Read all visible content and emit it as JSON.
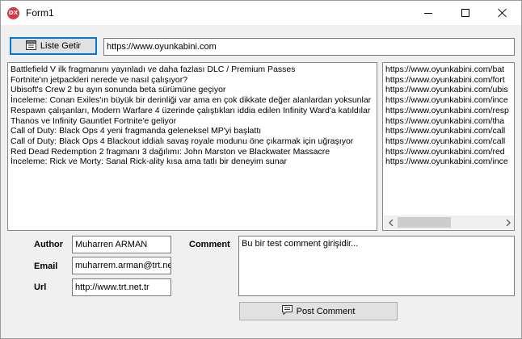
{
  "window": {
    "title": "Form1",
    "app_icon_text": "DX",
    "minimize_icon": "minimize-icon",
    "maximize_icon": "maximize-icon",
    "close_icon": "close-icon"
  },
  "toolbar": {
    "fetch_button_label": "Liste Getir",
    "fetch_button_icon": "window-list-icon",
    "url_value": "https://www.oyunkabini.com"
  },
  "titles_list": [
    "Battlefield V ilk fragmanını yayınladı ve daha fazlası DLC / Premium Passes",
    "Fortnite'ın jetpackleri  nerede  ve nasıl çalışıyor?",
    "Ubisoft's Crew 2 bu ayın sonunda beta sürümüne geçiyor",
    "İnceleme: Conan Exiles'ın büyük bir derinliği var ama en çok dikkate değer alanlardan yoksunlar",
    "Respawn çalışanları, Modern Warfare 4 üzerinde çalıştıkları iddia edilen Infinity Ward'a katıldılar",
    "Thanos ve Infinity Gauntlet  Fortnite'e geliyor",
    "Call of Duty: Black Ops 4 yeni fragmanda geleneksel MP'yi başlattı",
    "Call of Duty: Black Ops 4 Blackout iddialı savaş royale modunu öne çıkarmak için uğraşıyor",
    "Red Dead Redemption 2 fragmanı 3 dağılımı: John Marston ve Blackwater Massacre",
    "İnceleme: Rick ve Morty: Sanal Rick-ality kısa ama tatlı bir deneyim sunar"
  ],
  "links_list": [
    "https://www.oyunkabini.com/bat",
    "https://www.oyunkabini.com/fort",
    "https://www.oyunkabini.com/ubis",
    "https://www.oyunkabini.com/ince",
    "https://www.oyunkabini.com/resp",
    "https://www.oyunkabini.com/tha",
    "https://www.oyunkabini.com/call",
    "https://www.oyunkabini.com/call",
    "https://www.oyunkabini.com/red",
    "https://www.oyunkabini.com/ince"
  ],
  "form": {
    "author_label": "Author",
    "author_value": "Muharren ARMAN",
    "email_label": "Email",
    "email_value": "muharrem.arman@trt.net",
    "url_label": "Url",
    "url_value": "http://www.trt.net.tr",
    "comment_label": "Comment",
    "comment_value": "Bu bir test comment girişidir...",
    "post_button_label": "Post Comment",
    "post_button_icon": "comment-icon"
  }
}
